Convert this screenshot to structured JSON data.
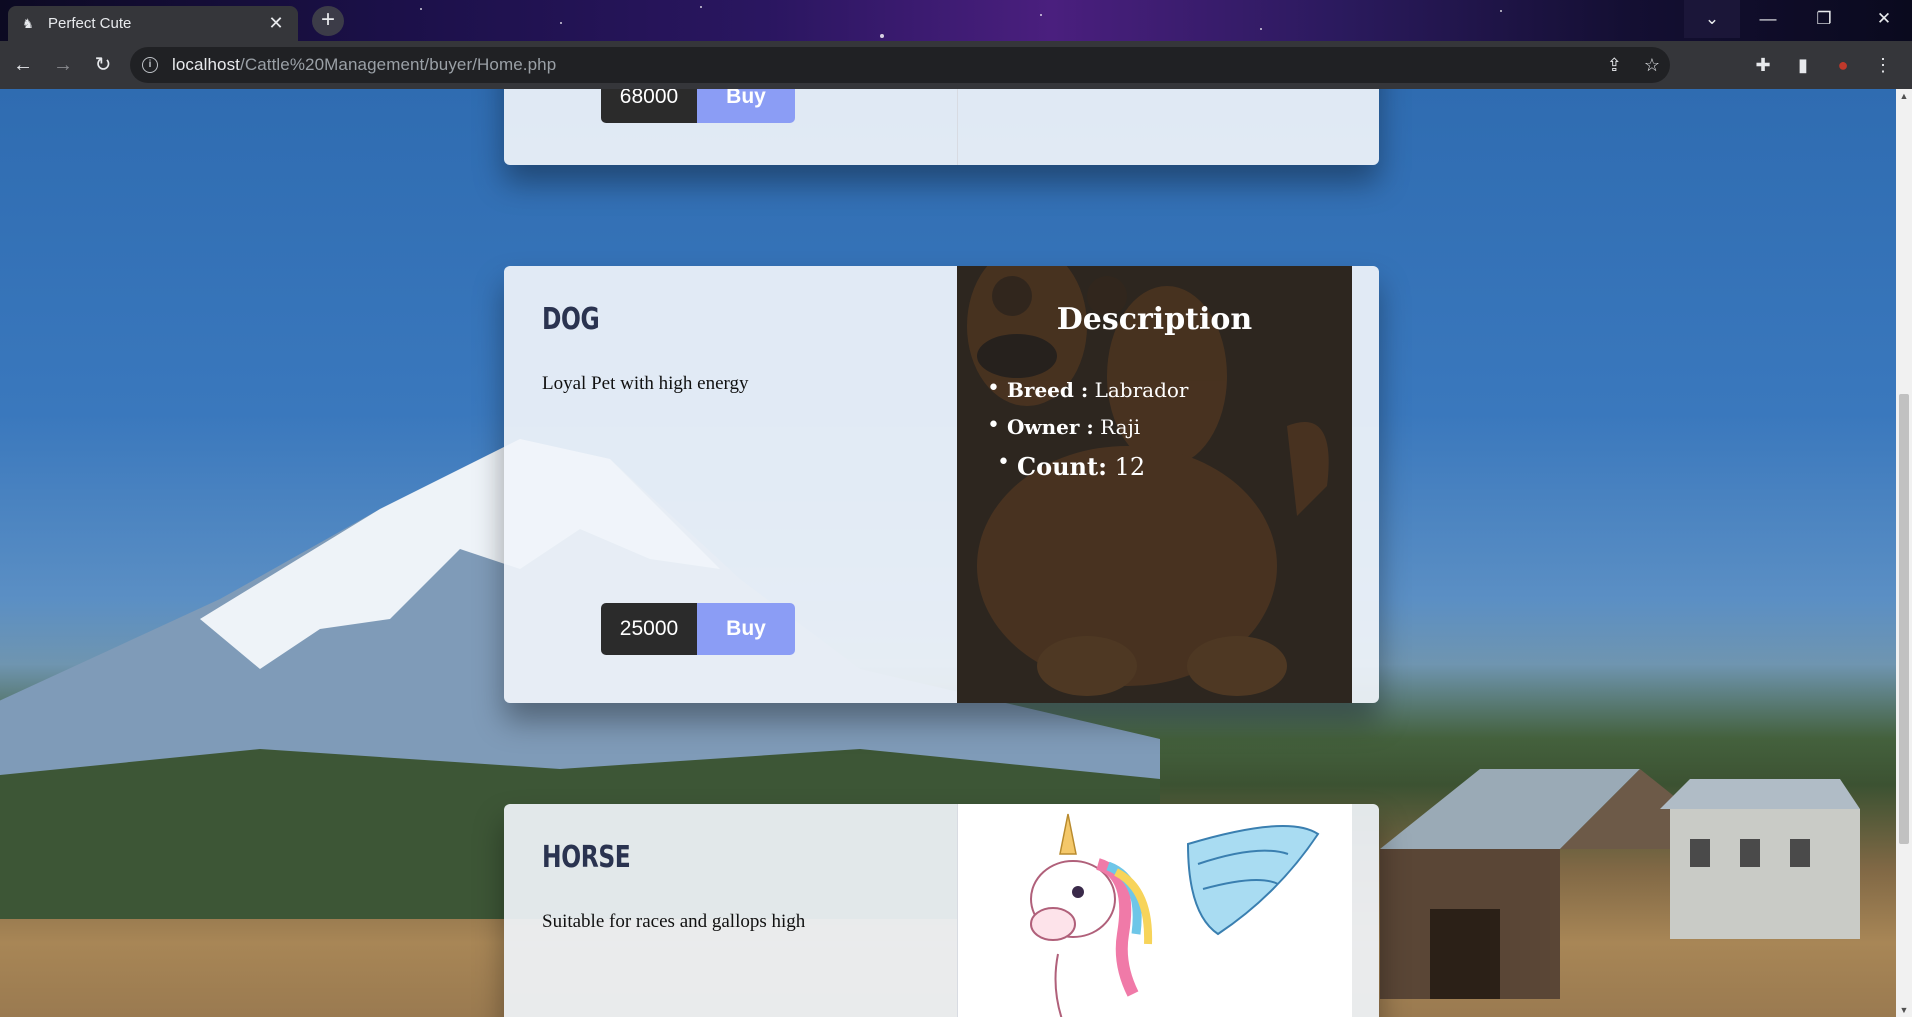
{
  "browser": {
    "tab_title": "Perfect Cute",
    "url_host": "localhost",
    "url_path": "/Cattle%20Management/buyer/Home.php"
  },
  "cards": [
    {
      "price": "68000",
      "buy_label": "Buy"
    },
    {
      "title": "DOG",
      "description": "Loyal Pet with high energy",
      "price": "25000",
      "buy_label": "Buy",
      "detail": {
        "heading": "Description",
        "breed_label": "Breed :",
        "breed_value": "Labrador",
        "owner_label": "Owner :",
        "owner_value": "Raji",
        "count_label": "Count:",
        "count_value": "12"
      }
    },
    {
      "title": "HORSE",
      "description": "Suitable for races and gallops high"
    }
  ],
  "icons": {
    "favicon": "cat-icon",
    "back": "arrow-left-icon",
    "forward": "arrow-right-icon",
    "reload": "reload-icon",
    "info": "info-icon",
    "share": "share-icon",
    "bookmark": "star-icon",
    "extensions": "puzzle-icon",
    "sidepanel": "side-panel-icon",
    "profile": "avatar",
    "menu": "kebab-menu-icon"
  }
}
